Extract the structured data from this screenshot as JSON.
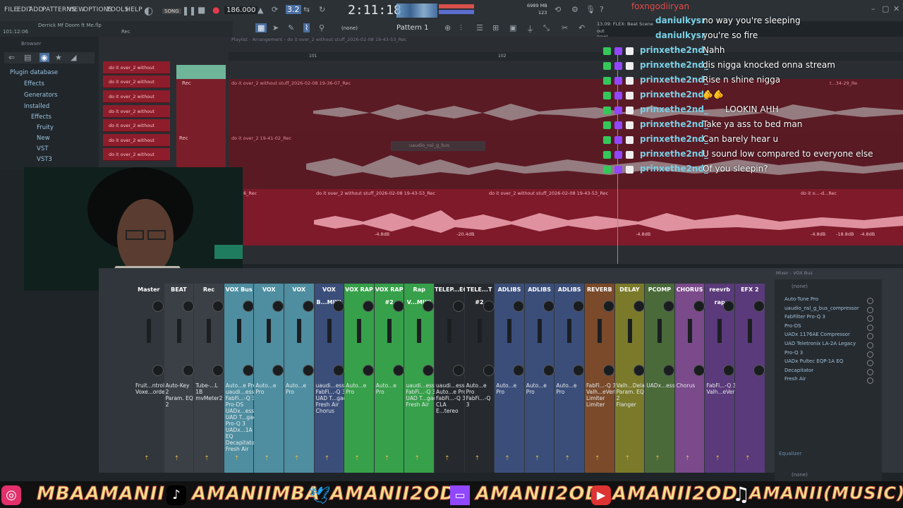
{
  "menu": [
    "FILE",
    "EDIT",
    "ADD",
    "PATTERNS",
    "VIEW",
    "OPTIONS",
    "TOOLS",
    "HELP"
  ],
  "transport": {
    "tempo": "186.000",
    "time": "2:11:18",
    "song_label": "SONG",
    "pattern": "Pattern 1",
    "snap": "(none)",
    "cpu": "6989 MB",
    "cpu2": "123"
  },
  "project": {
    "title": "Derrick Mf Doom ft Me.flp",
    "time": "101:12:06",
    "hint": "Rec"
  },
  "flex": {
    "line1": "13.09: FLEX: Beat Scene",
    "line2": "out now!"
  },
  "browser": {
    "title": "Browser",
    "items": [
      "Plugin database",
      "Effects",
      "Generators",
      "Installed",
      "Effects",
      "Fruity",
      "New",
      "VST",
      "VST3"
    ]
  },
  "playlist": {
    "header": "Playlist - Arrangement › do it over_2 without stuff_2026-02-08 19-43-53_Rec",
    "bar_markers": [
      "101",
      "102"
    ],
    "channel_rack": [
      "do it over_2 without",
      "do it over_2 without",
      "do it over_2 without",
      "do it over_2 without",
      "do it over_2 without",
      "do it over_2 without",
      "do it over_2 without"
    ],
    "track_labels": [
      "Rec",
      "Rec"
    ],
    "clips": [
      "do it over_2 without stuff_2026-02-08 19-36-07_Rec",
      "do it over_2 19-41-02_Rec",
      "do it over_2 without stuff_2026-02-08 19-43-53_Rec",
      "do it over_2 without stuff_2026-02-08 19-43-53_Rec"
    ],
    "ghost_label": "uaudio_nsl_g_bus",
    "db_labels": [
      "-4.8dB",
      "-20.4dB",
      "-4.8dB",
      "-4.8dB",
      "-18.8dB",
      "-4.8dB"
    ],
    "short_labels": [
      "6_Rec",
      "do it o...-d...Rec",
      "t...34-29_Re"
    ]
  },
  "chat": [
    {
      "user": "daniulkysr",
      "msg": "no way you're sleeping"
    },
    {
      "user": "daniulkysr",
      "msg": "you're so fire"
    },
    {
      "user": "prinxethe2nd_",
      "msg": "Nahh"
    },
    {
      "user": "prinxethe2nd_",
      "msg": "dis nigga knocked onna stream"
    },
    {
      "user": "prinxethe2nd_",
      "msg": "Rise n shine nigga"
    },
    {
      "user": "prinxethe2nd_",
      "msg": "🫵🫵"
    },
    {
      "user": "prinxethe2nd_",
      "msg": "LOOKIN AHH"
    },
    {
      "user": "prinxethe2nd_",
      "msg": "Take ya ass to bed man"
    },
    {
      "user": "prinxethe2nd_",
      "msg": "Can barely hear u"
    },
    {
      "user": "prinxethe2nd_",
      "msg": "U sound low compared to everyone else"
    },
    {
      "user": "prinxethe2nd_",
      "msg": "Of you sleepin?"
    }
  ],
  "chat_top_user": "foxngodiiryan",
  "mixer": {
    "title": "Mixer - VOX Bus",
    "strips": [
      {
        "label": "Master",
        "color": "#30363b",
        "fx": [
          "Fruit...ntrole",
          "Voxe...order"
        ]
      },
      {
        "label": "BEAT",
        "color": "#3a4046",
        "fx": [
          "Auto-Key 2",
          "Param. EQ 2"
        ]
      },
      {
        "label": "Rec",
        "color": "#3a4046",
        "fx": [
          "Tube-...L 1B",
          "mvMeter2"
        ]
      },
      {
        "label": "VOX Bus",
        "color": "#4e8ea0",
        "fx": [
          "Auto...e Pro",
          "uaudi...essor",
          "FabFi...-Q 3",
          "Pro-DS",
          "UADx...essor",
          "UAD T...gacy",
          "Pro-Q 3",
          "UADx...1A EQ",
          "Decapitator",
          "Fresh Air"
        ]
      },
      {
        "label": "VOX",
        "color": "#4e8ea0",
        "fx": [
          "Auto...e Pro"
        ]
      },
      {
        "label": "VOX",
        "color": "#4e8ea0",
        "fx": [
          "Auto...e Pro"
        ]
      },
      {
        "label": "VOX B...MIX)",
        "color": "#3b4e7a",
        "fx": [
          "uaudi...essor",
          "FabFi...-Q 3",
          "UAD T...gacy",
          "Fresh Air",
          "Chorus"
        ]
      },
      {
        "label": "VOX RAP",
        "color": "#37a04a",
        "fx": [
          "Auto...e Pro"
        ]
      },
      {
        "label": "VOX RAP #2",
        "color": "#37a04a",
        "fx": [
          "Auto...e Pro"
        ]
      },
      {
        "label": "Rap V...MIX)",
        "color": "#37a04a",
        "fx": [
          "uaudi...essor",
          "FabFi...-Q 3",
          "UAD T...gacy",
          "Fresh Air"
        ]
      },
      {
        "label": "TELEP...ECT",
        "color": "#262a2e",
        "fx": [
          "uaudi...essor",
          "Auto...e Pro",
          "FabFi...-Q 3",
          "CLA E...tereo"
        ]
      },
      {
        "label": "TELE...T #2",
        "color": "#262a2e",
        "fx": [
          "Auto...e Pro",
          "FabFi...-Q 3"
        ]
      },
      {
        "label": "ADLIBS",
        "color": "#3b4e7a",
        "fx": [
          "Auto...e Pro"
        ]
      },
      {
        "label": "ADLIBS",
        "color": "#3b4e7a",
        "fx": [
          "Auto...e Pro"
        ]
      },
      {
        "label": "ADLIBS",
        "color": "#3b4e7a",
        "fx": [
          "Auto...e Pro"
        ]
      },
      {
        "label": "REVERB",
        "color": "#7a4a2a",
        "fx": [
          "FabFi...-Q 3",
          "Valh...eVerb",
          "Limiter",
          "Limiter"
        ]
      },
      {
        "label": "DELAY",
        "color": "#7a7a2a",
        "fx": [
          "Valh...Delay",
          "Param. EQ 2",
          "Flanger"
        ]
      },
      {
        "label": "PCOMP",
        "color": "#4a6a3a",
        "fx": [
          "UADx...essor"
        ]
      },
      {
        "label": "CHORUS",
        "color": "#7a4a8a",
        "fx": [
          "Chorus"
        ]
      },
      {
        "label": "reevrb rap",
        "color": "#5a3a7a",
        "fx": [
          "FabFi...-Q 3",
          "Valh...eVerb"
        ]
      },
      {
        "label": "EFX 2",
        "color": "#5a3a7a",
        "fx": []
      }
    ],
    "slot_selector": "(none)",
    "fx_slots": [
      "Auto-Tune Pro",
      "uaudio_nsl_g_bus_compressor",
      "FabFilter Pro-Q 3",
      "Pro-DS",
      "UADx 1176AE Compressor",
      "UAD Teletronix LA-2A Legacy",
      "Pro-Q 3",
      "UADx Pultec EQP-1A EQ",
      "Decapitator",
      "Fresh Air"
    ],
    "eq_label": "Equalizer",
    "bottom_selector": "(none)"
  },
  "socials": [
    "MBAAMANII",
    "AMANIIMBA",
    "AMANII2OD",
    "AMANII2OD",
    "AMANII2OD",
    "AMANII(MUSIC)"
  ],
  "colors": {
    "accent": "#e63b4d",
    "chat_user": "#7ad0e6",
    "ticker": "#f3e18a"
  }
}
